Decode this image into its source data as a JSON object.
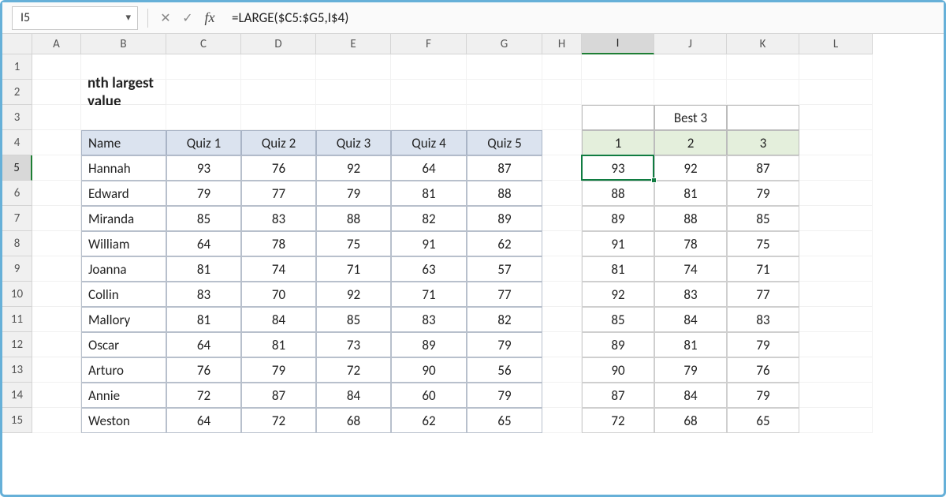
{
  "name_box": "I5",
  "formula": "=LARGE($C5:$G5,I$4)",
  "title": "nth largest value",
  "columns": [
    "A",
    "B",
    "C",
    "D",
    "E",
    "F",
    "G",
    "H",
    "I",
    "J",
    "K",
    "L"
  ],
  "rows": [
    "1",
    "2",
    "3",
    "4",
    "5",
    "6",
    "7",
    "8",
    "9",
    "10",
    "11",
    "12",
    "13",
    "14",
    "15"
  ],
  "active_col": "I",
  "active_row": "5",
  "table": {
    "headers": [
      "Name",
      "Quiz 1",
      "Quiz 2",
      "Quiz 3",
      "Quiz 4",
      "Quiz 5"
    ],
    "rows": [
      {
        "name": "Hannah",
        "q": [
          93,
          76,
          92,
          64,
          87
        ]
      },
      {
        "name": "Edward",
        "q": [
          79,
          77,
          79,
          81,
          88
        ]
      },
      {
        "name": "Miranda",
        "q": [
          85,
          83,
          88,
          82,
          89
        ]
      },
      {
        "name": "William",
        "q": [
          64,
          78,
          75,
          91,
          62
        ]
      },
      {
        "name": "Joanna",
        "q": [
          81,
          74,
          71,
          63,
          57
        ]
      },
      {
        "name": "Collin",
        "q": [
          83,
          70,
          92,
          71,
          77
        ]
      },
      {
        "name": "Mallory",
        "q": [
          81,
          84,
          85,
          83,
          82
        ]
      },
      {
        "name": "Oscar",
        "q": [
          64,
          81,
          73,
          89,
          79
        ]
      },
      {
        "name": "Arturo",
        "q": [
          76,
          79,
          72,
          90,
          56
        ]
      },
      {
        "name": "Annie",
        "q": [
          72,
          87,
          84,
          60,
          79
        ]
      },
      {
        "name": "Weston",
        "q": [
          64,
          72,
          68,
          62,
          65
        ]
      }
    ]
  },
  "best": {
    "title": "Best 3",
    "n": [
      1,
      2,
      3
    ],
    "rows": [
      [
        93,
        92,
        87
      ],
      [
        88,
        81,
        79
      ],
      [
        89,
        88,
        85
      ],
      [
        91,
        78,
        75
      ],
      [
        81,
        74,
        71
      ],
      [
        92,
        83,
        77
      ],
      [
        85,
        84,
        83
      ],
      [
        89,
        81,
        79
      ],
      [
        90,
        79,
        76
      ],
      [
        87,
        84,
        79
      ],
      [
        72,
        68,
        65
      ]
    ]
  },
  "chart_data": {
    "type": "table",
    "title": "nth largest value",
    "quiz": {
      "columns": [
        "Name",
        "Quiz 1",
        "Quiz 2",
        "Quiz 3",
        "Quiz 4",
        "Quiz 5"
      ],
      "rows": [
        [
          "Hannah",
          93,
          76,
          92,
          64,
          87
        ],
        [
          "Edward",
          79,
          77,
          79,
          81,
          88
        ],
        [
          "Miranda",
          85,
          83,
          88,
          82,
          89
        ],
        [
          "William",
          64,
          78,
          75,
          91,
          62
        ],
        [
          "Joanna",
          81,
          74,
          71,
          63,
          57
        ],
        [
          "Collin",
          83,
          70,
          92,
          71,
          77
        ],
        [
          "Mallory",
          81,
          84,
          85,
          83,
          82
        ],
        [
          "Oscar",
          64,
          81,
          73,
          89,
          79
        ],
        [
          "Arturo",
          76,
          79,
          72,
          90,
          56
        ],
        [
          "Annie",
          72,
          87,
          84,
          60,
          79
        ],
        [
          "Weston",
          64,
          72,
          68,
          62,
          65
        ]
      ]
    },
    "best3": {
      "columns": [
        1,
        2,
        3
      ],
      "rows": [
        [
          93,
          92,
          87
        ],
        [
          88,
          81,
          79
        ],
        [
          89,
          88,
          85
        ],
        [
          91,
          78,
          75
        ],
        [
          81,
          74,
          71
        ],
        [
          92,
          83,
          77
        ],
        [
          85,
          84,
          83
        ],
        [
          89,
          81,
          79
        ],
        [
          90,
          79,
          76
        ],
        [
          87,
          84,
          79
        ],
        [
          72,
          68,
          65
        ]
      ]
    }
  }
}
